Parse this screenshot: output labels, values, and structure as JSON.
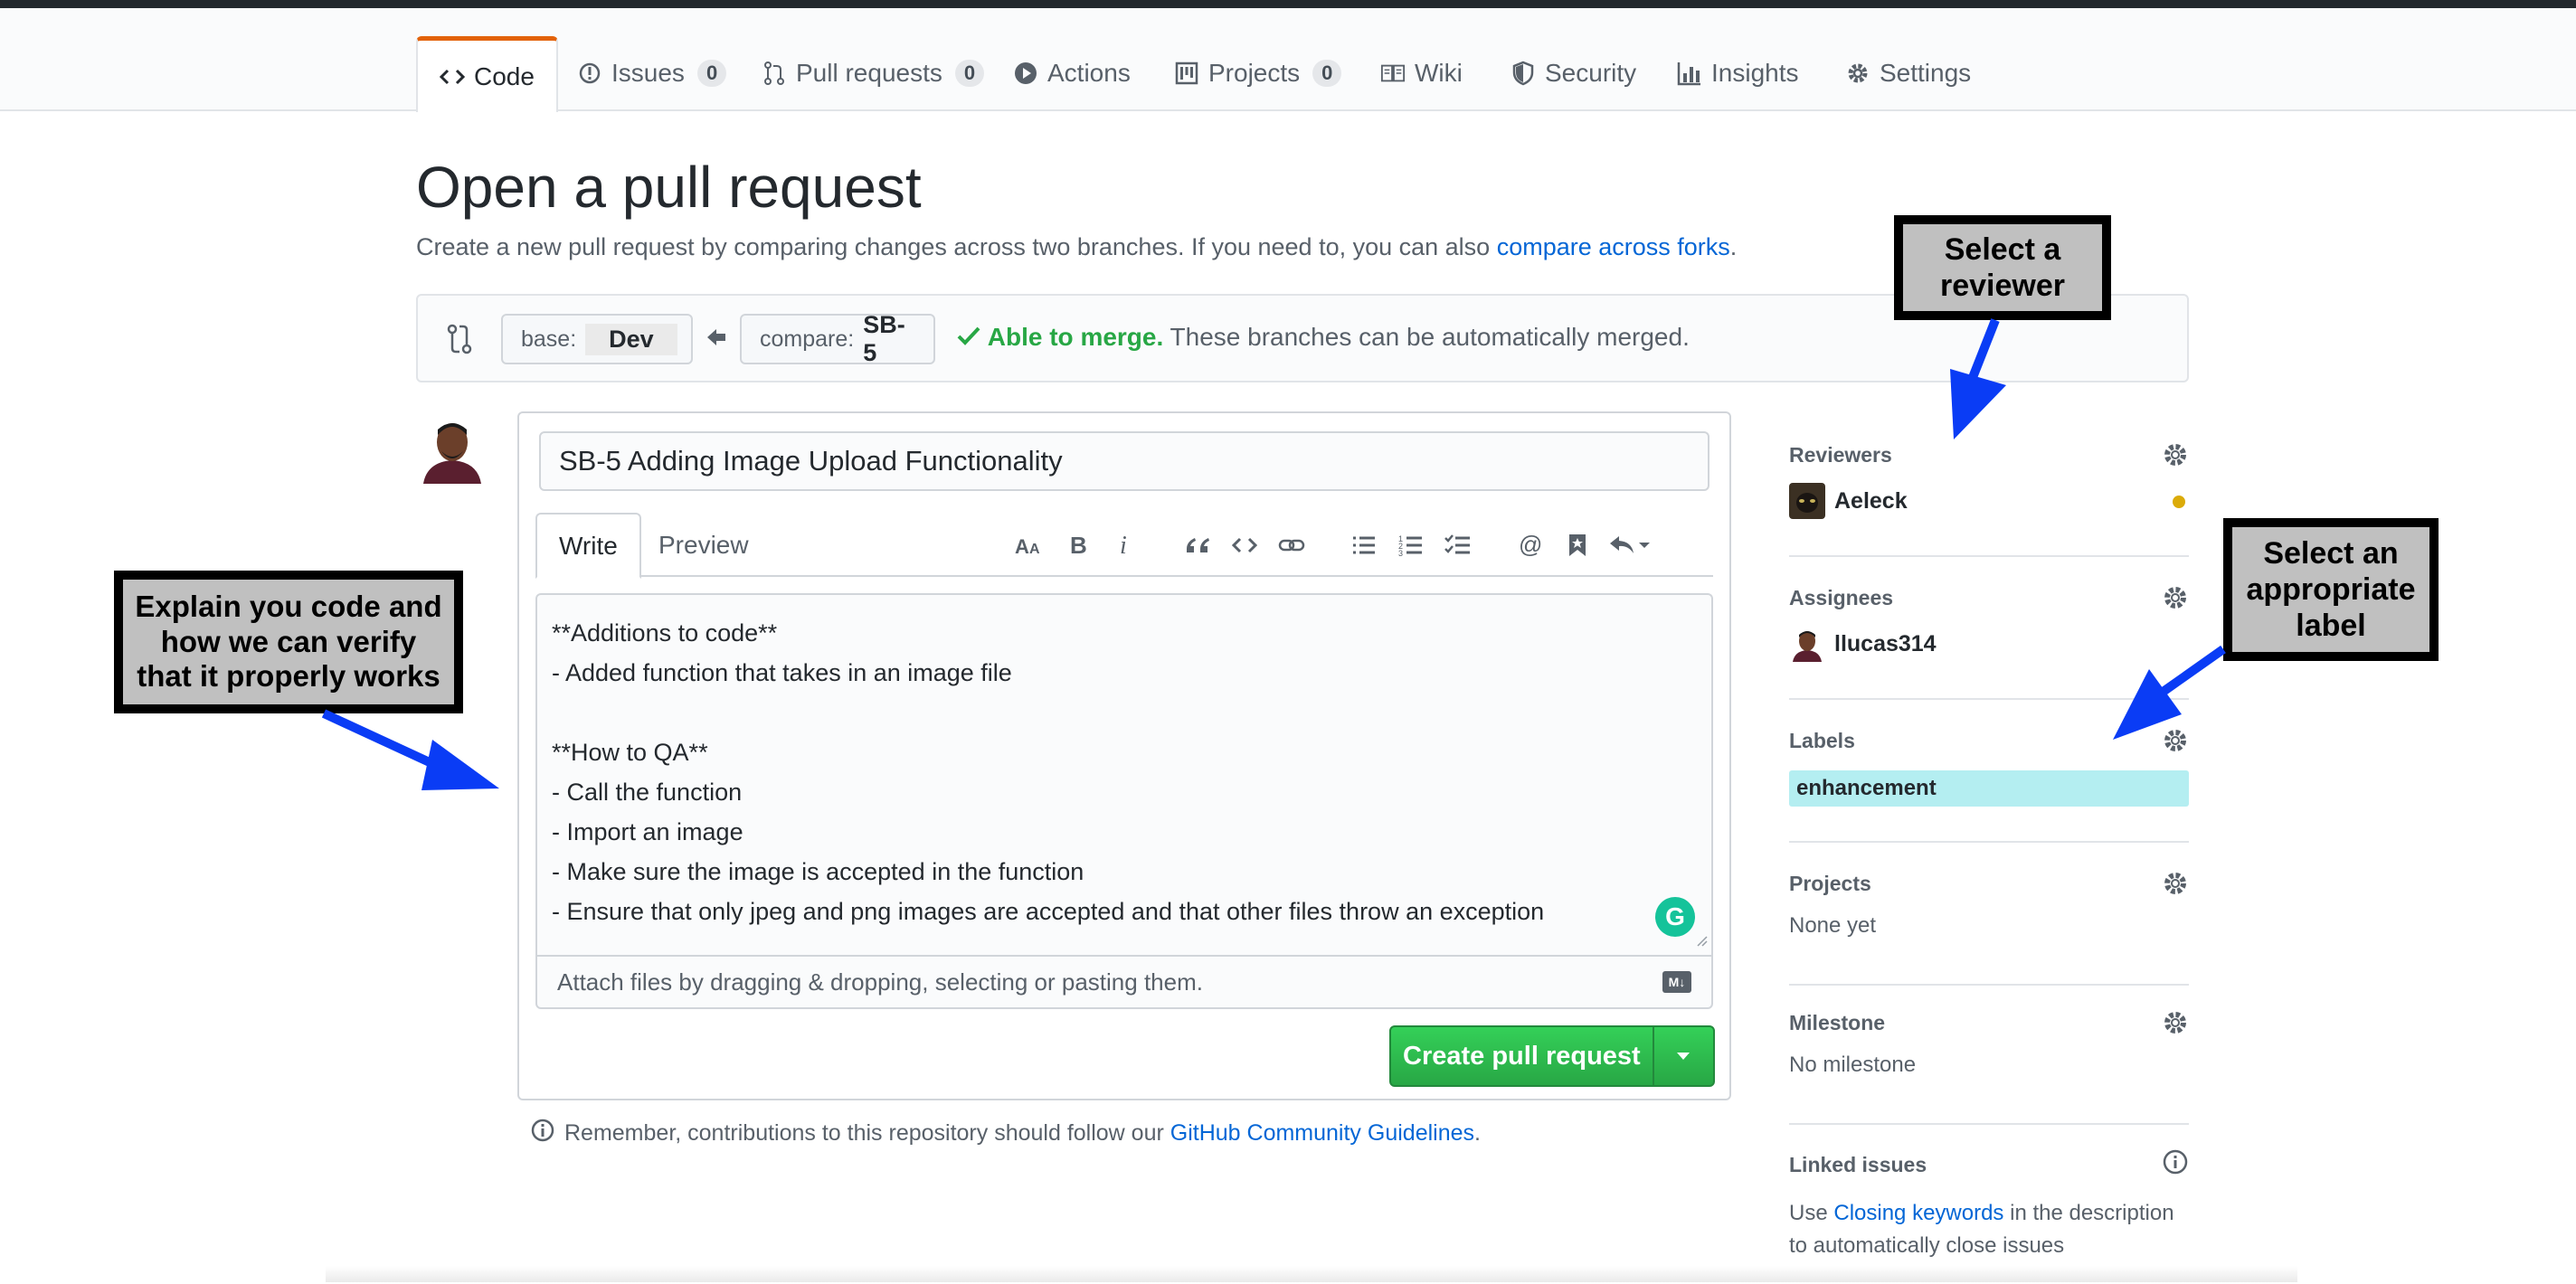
{
  "repo_nav": {
    "tabs": [
      {
        "label": "Code",
        "icon": "code-icon",
        "selected": true
      },
      {
        "label": "Issues",
        "count": "0",
        "icon": "issue-icon"
      },
      {
        "label": "Pull requests",
        "count": "0",
        "icon": "pull-request-icon"
      },
      {
        "label": "Actions",
        "icon": "play-icon"
      },
      {
        "label": "Projects",
        "count": "0",
        "icon": "project-icon"
      },
      {
        "label": "Wiki",
        "icon": "book-icon"
      },
      {
        "label": "Security",
        "icon": "shield-icon"
      },
      {
        "label": "Insights",
        "icon": "graph-icon"
      },
      {
        "label": "Settings",
        "icon": "gear-icon"
      }
    ]
  },
  "page": {
    "title": "Open a pull request",
    "subtitle": "Create a new pull request by comparing changes across two branches. If you need to, you can also ",
    "subtitle_link": "compare across forks",
    "subtitle_end": "."
  },
  "range": {
    "base_label": "base:",
    "base_value": "Dev",
    "compare_label": "compare:",
    "compare_value": "SB-5",
    "merge_status": "Able to merge.",
    "merge_detail": " These branches can be automatically merged."
  },
  "form": {
    "title_value": "SB-5 Adding Image Upload Functionality",
    "tab_write": "Write",
    "tab_preview": "Preview",
    "body_lines": [
      "**Additions to code**",
      "- Added function that takes in an image file",
      "",
      "**How to QA**",
      "- Call the function",
      "- Import an image",
      "- Make sure the image is accepted in the function",
      "- Ensure that only jpeg and png images are accepted and that other files throw an exception"
    ],
    "attach_hint": "Attach files by dragging & dropping, selecting or pasting them.",
    "markdown_badge": "M↓",
    "submit_label": "Create pull request"
  },
  "guidelines": {
    "text": "Remember, contributions to this repository should follow our ",
    "link": "GitHub Community Guidelines",
    "end": "."
  },
  "sidebar": {
    "reviewers": {
      "heading": "Reviewers",
      "name": "Aeleck"
    },
    "assignees": {
      "heading": "Assignees",
      "name": "llucas314"
    },
    "labels": {
      "heading": "Labels",
      "label": "enhancement",
      "label_color": "#b4eef1"
    },
    "projects": {
      "heading": "Projects",
      "value": "None yet"
    },
    "milestone": {
      "heading": "Milestone",
      "value": "No milestone"
    },
    "linked_issues": {
      "heading": "Linked issues",
      "text_prefix": "Use ",
      "link": "Closing keywords",
      "text_suffix": " in the description",
      "text_line2": "to automatically close issues"
    }
  },
  "annotations": {
    "reviewer": [
      "Select a",
      "reviewer"
    ],
    "label": [
      "Select an",
      "appropriate",
      "label"
    ],
    "explain": [
      "Explain you code and",
      "how we can verify",
      "that it properly works"
    ]
  },
  "colors": {
    "accent_orange": "#e36209",
    "link_blue": "#0366d6",
    "success_green": "#28a745",
    "arrow_blue": "#0a3cf5",
    "pending_dot": "#dbab09"
  }
}
